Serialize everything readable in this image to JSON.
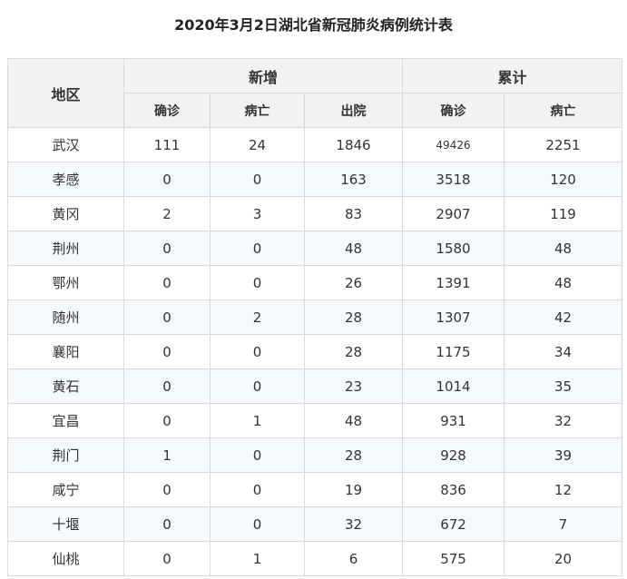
{
  "title": "2020年3月2日湖北省新冠肺炎病例统计表",
  "headers": {
    "region": "地区",
    "new_group": "新增",
    "cumulative_group": "累计",
    "new_confirmed": "确诊",
    "new_deaths": "病亡",
    "new_discharged": "出院",
    "cum_confirmed": "确诊",
    "cum_deaths": "病亡"
  },
  "rows": [
    {
      "region": "武汉",
      "new_confirmed": "111",
      "new_deaths": "24",
      "new_discharged": "1846",
      "cum_confirmed": "49426",
      "cum_deaths": "2251"
    },
    {
      "region": "孝感",
      "new_confirmed": "0",
      "new_deaths": "0",
      "new_discharged": "163",
      "cum_confirmed": "3518",
      "cum_deaths": "120"
    },
    {
      "region": "黄冈",
      "new_confirmed": "2",
      "new_deaths": "3",
      "new_discharged": "83",
      "cum_confirmed": "2907",
      "cum_deaths": "119"
    },
    {
      "region": "荆州",
      "new_confirmed": "0",
      "new_deaths": "0",
      "new_discharged": "48",
      "cum_confirmed": "1580",
      "cum_deaths": "48"
    },
    {
      "region": "鄂州",
      "new_confirmed": "0",
      "new_deaths": "0",
      "new_discharged": "26",
      "cum_confirmed": "1391",
      "cum_deaths": "48"
    },
    {
      "region": "随州",
      "new_confirmed": "0",
      "new_deaths": "2",
      "new_discharged": "28",
      "cum_confirmed": "1307",
      "cum_deaths": "42"
    },
    {
      "region": "襄阳",
      "new_confirmed": "0",
      "new_deaths": "0",
      "new_discharged": "28",
      "cum_confirmed": "1175",
      "cum_deaths": "34"
    },
    {
      "region": "黄石",
      "new_confirmed": "0",
      "new_deaths": "0",
      "new_discharged": "23",
      "cum_confirmed": "1014",
      "cum_deaths": "35"
    },
    {
      "region": "宜昌",
      "new_confirmed": "0",
      "new_deaths": "1",
      "new_discharged": "48",
      "cum_confirmed": "931",
      "cum_deaths": "32"
    },
    {
      "region": "荆门",
      "new_confirmed": "1",
      "new_deaths": "0",
      "new_discharged": "28",
      "cum_confirmed": "928",
      "cum_deaths": "39"
    },
    {
      "region": "咸宁",
      "new_confirmed": "0",
      "new_deaths": "0",
      "new_discharged": "19",
      "cum_confirmed": "836",
      "cum_deaths": "12"
    },
    {
      "region": "十堰",
      "new_confirmed": "0",
      "new_deaths": "0",
      "new_discharged": "32",
      "cum_confirmed": "672",
      "cum_deaths": "7"
    },
    {
      "region": "仙桃",
      "new_confirmed": "0",
      "new_deaths": "1",
      "new_discharged": "6",
      "cum_confirmed": "575",
      "cum_deaths": "20"
    }
  ]
}
